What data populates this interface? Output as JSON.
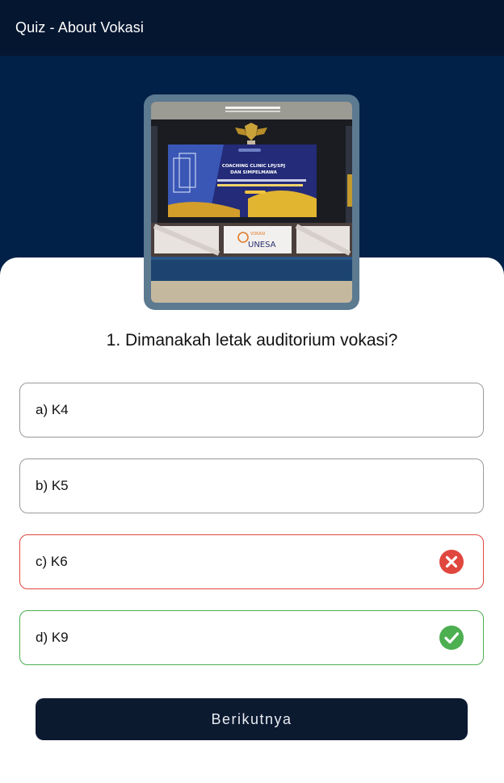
{
  "appbar": {
    "title": "Quiz - About Vokasi"
  },
  "image": {
    "description_icon": "photo-auditorium",
    "banner_line1": "COACHING CLINIC LPJ/SPJ",
    "banner_line2": "DAN SIMPELMAWA",
    "logo_top": "VOKASI",
    "logo_bottom": "UNESA"
  },
  "question": {
    "text": "1. Dimanakah letak auditorium vokasi?"
  },
  "options": [
    {
      "label": "a) K4",
      "state": "neutral"
    },
    {
      "label": "b) K5",
      "state": "neutral"
    },
    {
      "label": "c) K6",
      "state": "wrong"
    },
    {
      "label": "d) K9",
      "state": "correct"
    }
  ],
  "colors": {
    "appbar": "#051630",
    "hero": "#022148",
    "wrong": "#e0473e",
    "correct": "#4caf50",
    "button": "#0c1a30"
  },
  "next_button": {
    "label": "Berikutnya"
  }
}
